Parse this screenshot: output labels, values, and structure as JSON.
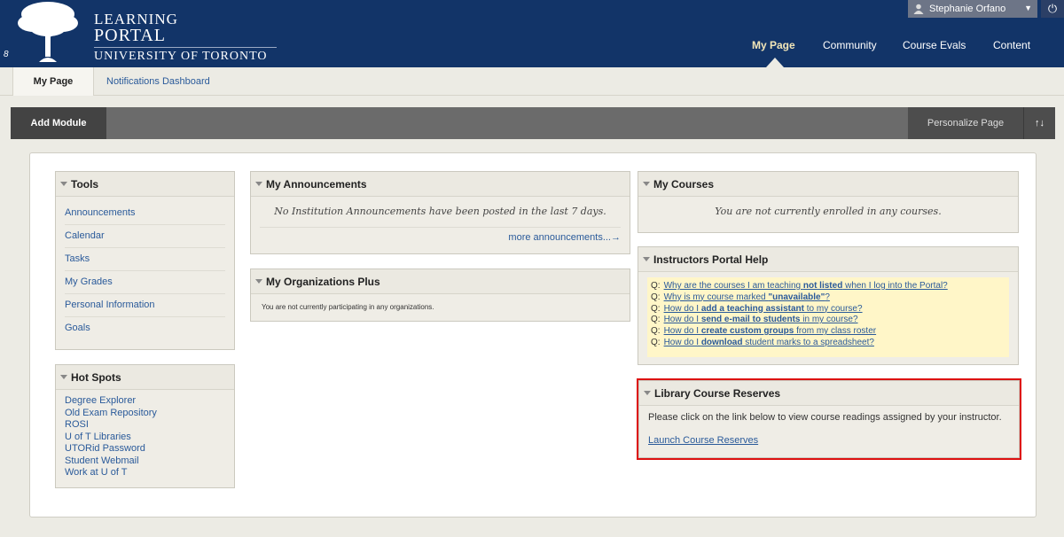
{
  "header": {
    "logo_line1": "LEARNING",
    "logo_line2": "PORTAL",
    "logo_line3": "UNIVERSITY OF TORONTO",
    "corner_mark": "8",
    "user_name": "Stephanie Orfano",
    "nav": [
      {
        "label": "My Page",
        "active": true
      },
      {
        "label": "Community",
        "active": false
      },
      {
        "label": "Course Evals",
        "active": false
      },
      {
        "label": "Content",
        "active": false
      }
    ]
  },
  "subtabs": {
    "active": "My Page",
    "other": "Notifications Dashboard"
  },
  "toolbar": {
    "add_module": "Add Module",
    "personalize": "Personalize Page",
    "reorder": "↑↓"
  },
  "tools": {
    "title": "Tools",
    "items": [
      "Announcements",
      "Calendar",
      "Tasks",
      "My Grades",
      "Personal Information",
      "Goals"
    ]
  },
  "hot_spots": {
    "title": "Hot Spots",
    "items": [
      "Degree Explorer",
      "Old Exam Repository",
      "ROSI",
      "U of T Libraries",
      "UTORid Password",
      "Student Webmail",
      "Work at U of T"
    ]
  },
  "announcements": {
    "title": "My Announcements",
    "message": "No Institution Announcements have been posted in the last 7 days.",
    "more": "more announcements...→"
  },
  "organizations": {
    "title": "My Organizations Plus",
    "message": "You are not currently participating in any organizations."
  },
  "courses": {
    "title": "My Courses",
    "message": "You are not currently enrolled in any courses."
  },
  "help": {
    "title": "Instructors Portal Help",
    "q_label": "Q:",
    "questions": [
      {
        "pre": "Why are the courses I am teaching ",
        "bold": "not listed",
        "post": " when I log into the Portal?"
      },
      {
        "pre": "Why is my course marked ",
        "bold": "\"unavailable\"",
        "post": "?"
      },
      {
        "pre": "How do I ",
        "bold": "add a teaching assistant",
        "post": " to my course?"
      },
      {
        "pre": "How do I ",
        "bold": "send e-mail to students",
        "post": " in my course?"
      },
      {
        "pre": "How do I ",
        "bold": "create custom groups",
        "post": " from my class roster"
      },
      {
        "pre": "How do I ",
        "bold": "download",
        "post": " student marks to a spreadsheet?"
      }
    ]
  },
  "library": {
    "title": "Library Course Reserves",
    "text": "Please click on the link below to view course readings assigned by your instructor.",
    "link": "Launch Course Reserves"
  }
}
